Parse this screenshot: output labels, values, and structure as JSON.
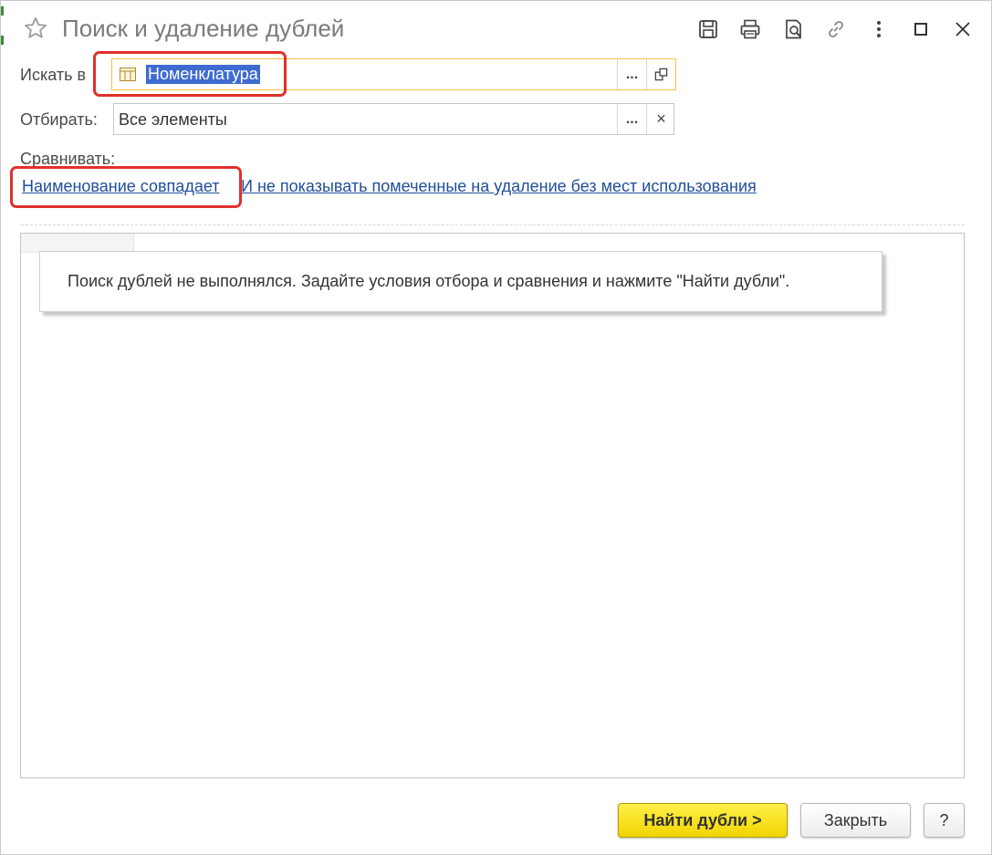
{
  "window": {
    "title": "Поиск и удаление дублей",
    "toolbar_icons": [
      "save-icon",
      "print-icon",
      "preview-icon",
      "link-icon",
      "more-icon",
      "maximize-icon",
      "close-icon"
    ]
  },
  "form": {
    "search_in": {
      "label": "Искать в",
      "value": "Номенклатура",
      "select_btn": "...",
      "open_btn_icon": "open-icon"
    },
    "filter": {
      "label": "Отбирать:",
      "value": "Все элементы",
      "select_btn": "...",
      "clear_btn": "×"
    },
    "compare": {
      "label": "Сравнивать:",
      "condition_link": "Наименование совпадает",
      "option_link": "И не показывать помеченные на удаление без мест использования"
    }
  },
  "results": {
    "message": "Поиск дублей не выполнялся.  Задайте условия отбора и сравнения и нажмите \"Найти дубли\"."
  },
  "buttons": {
    "find": "Найти дубли >",
    "close": "Закрыть",
    "help": "?"
  },
  "colors": {
    "accent_yellow": "#f1d500",
    "link_blue": "#1f4e9c",
    "highlight_red": "#e0312c",
    "selection_blue": "#3f6bd1",
    "focus_border": "#f2c53d"
  }
}
